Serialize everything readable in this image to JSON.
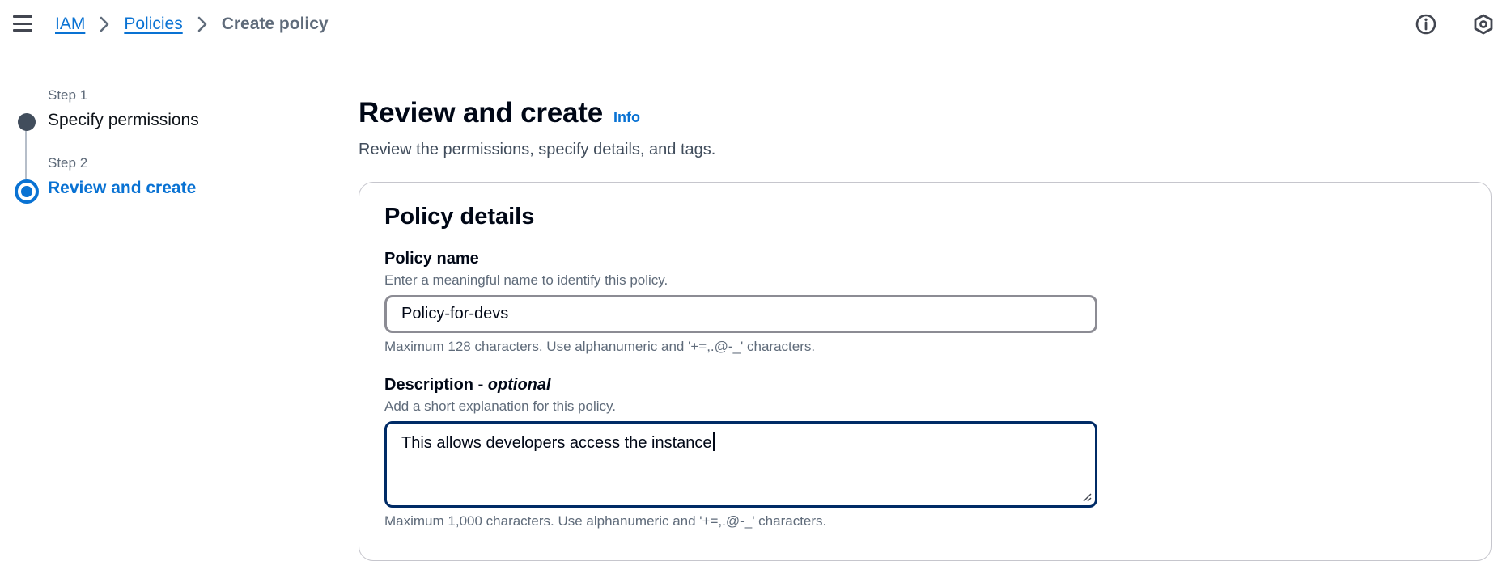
{
  "breadcrumb": {
    "items": [
      {
        "label": "IAM"
      },
      {
        "label": "Policies"
      }
    ],
    "current": "Create policy"
  },
  "header": {
    "icons": [
      "menu-icon",
      "info-circle-icon",
      "hexagon-icon"
    ]
  },
  "steps": [
    {
      "step_label": "Step 1",
      "title": "Specify permissions",
      "state": "completed"
    },
    {
      "step_label": "Step 2",
      "title": "Review and create",
      "state": "current"
    }
  ],
  "main": {
    "title": "Review and create",
    "info_link": "Info",
    "subtitle": "Review the permissions, specify details, and tags."
  },
  "policy_details": {
    "heading": "Policy details",
    "name_field": {
      "label": "Policy name",
      "description": "Enter a meaningful name to identify this policy.",
      "value": "Policy-for-devs",
      "constraint": "Maximum 128 characters. Use alphanumeric and '+=,.@-_' characters."
    },
    "description_field": {
      "label": "Description - ",
      "label_optional": "optional",
      "description": "Add a short explanation for this policy.",
      "value": "This allows developers access the instance",
      "constraint": "Maximum 1,000 characters. Use alphanumeric and '+=,.@-_' characters."
    }
  },
  "colors": {
    "link": "#0972d3",
    "text": "#000716",
    "secondary_text": "#5f6b7a",
    "focus_border": "#002b66",
    "step_done": "#414d5c"
  }
}
